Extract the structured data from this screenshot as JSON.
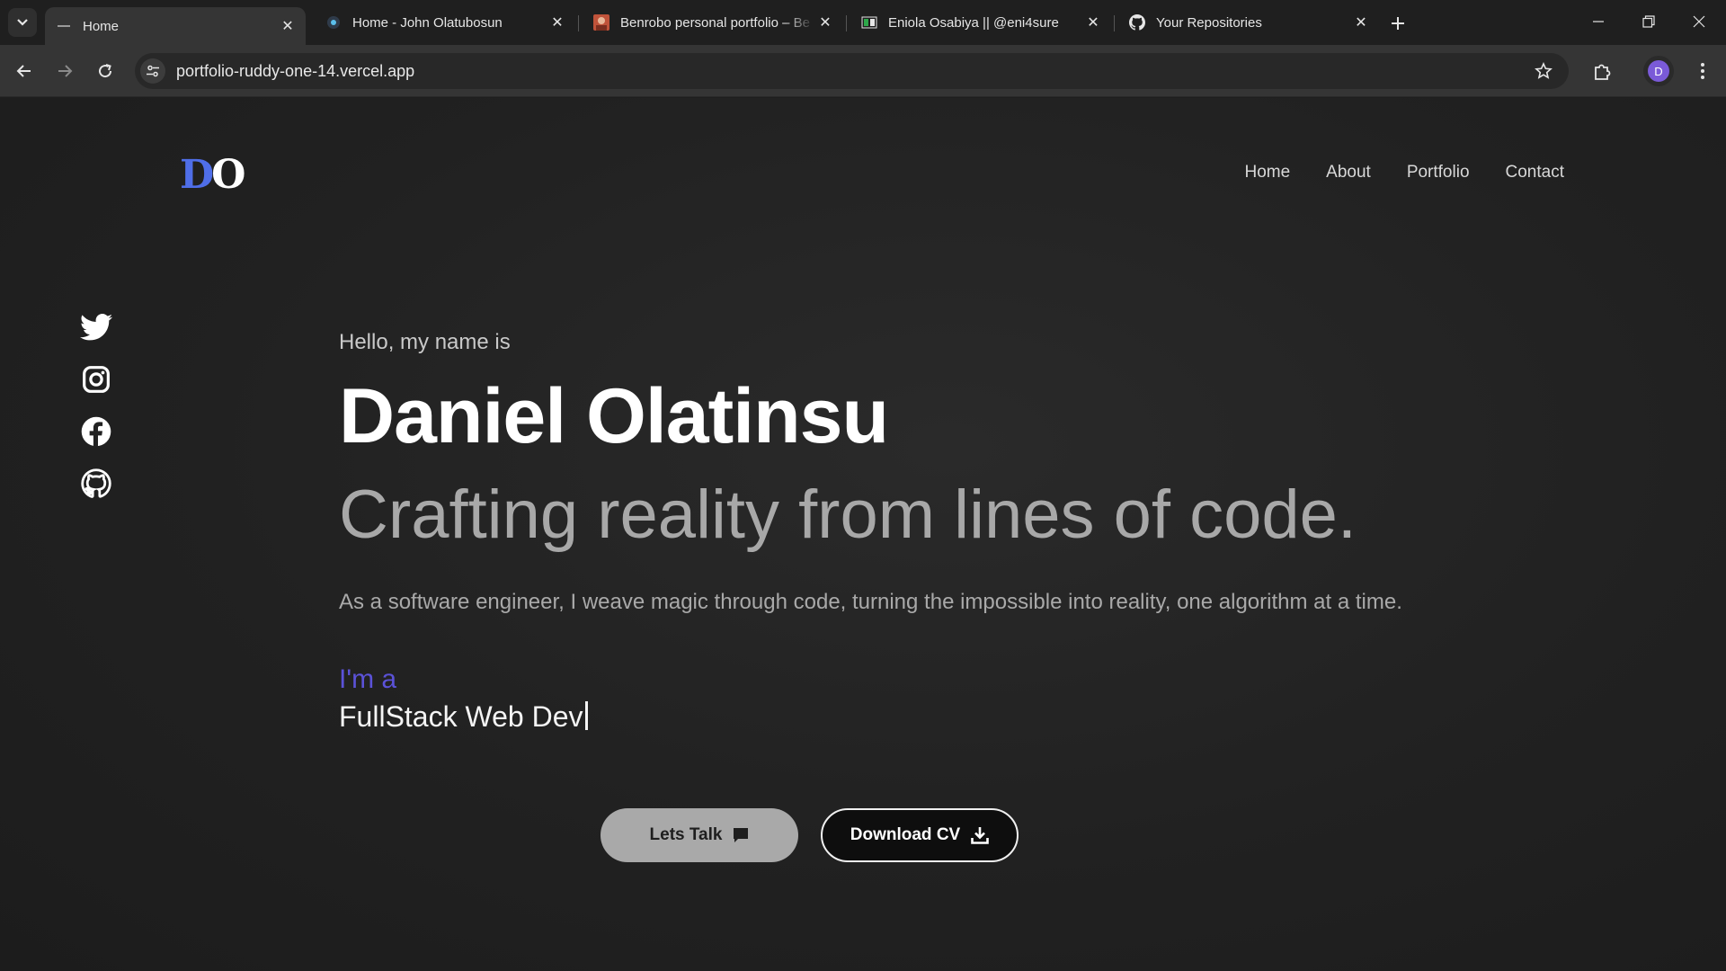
{
  "browser": {
    "tabs": [
      {
        "title": "Home",
        "favicon": "dash-icon",
        "active": true
      },
      {
        "title": "Home - John Olatubosun",
        "favicon": "site-globe-icon"
      },
      {
        "title": "Benrobo personal portfolio – Be",
        "favicon": "avatar-photo-icon"
      },
      {
        "title": "Eniola Osabiya || @eni4sure",
        "favicon": "green-site-icon"
      },
      {
        "title": "Your Repositories",
        "favicon": "github-icon"
      }
    ],
    "url": "portfolio-ruddy-one-14.vercel.app",
    "profile_initial": "D",
    "colors": {
      "profile": "#7a5ad8",
      "chrome_dark": "#1f1f1f",
      "toolbar": "#353535"
    }
  },
  "site": {
    "logo": {
      "d": "D",
      "o": "O",
      "accent": "#4f6ee8"
    },
    "nav": {
      "home": "Home",
      "about": "About",
      "portfolio": "Portfolio",
      "contact": "Contact"
    },
    "socials": [
      "twitter-icon",
      "instagram-icon",
      "facebook-icon",
      "github-icon"
    ],
    "hero": {
      "greeting": "Hello, my name is",
      "name": "Daniel Olatinsu",
      "tagline": "Crafting reality from lines of code.",
      "description": "As a software engineer, I weave magic through code, turning the impossible into reality, one algorithm at a time.",
      "im_a": "I'm a",
      "role": "FullStack Web Dev",
      "accent": "#5b52d8"
    },
    "buttons": {
      "talk": "Lets Talk",
      "cv": "Download CV"
    }
  }
}
